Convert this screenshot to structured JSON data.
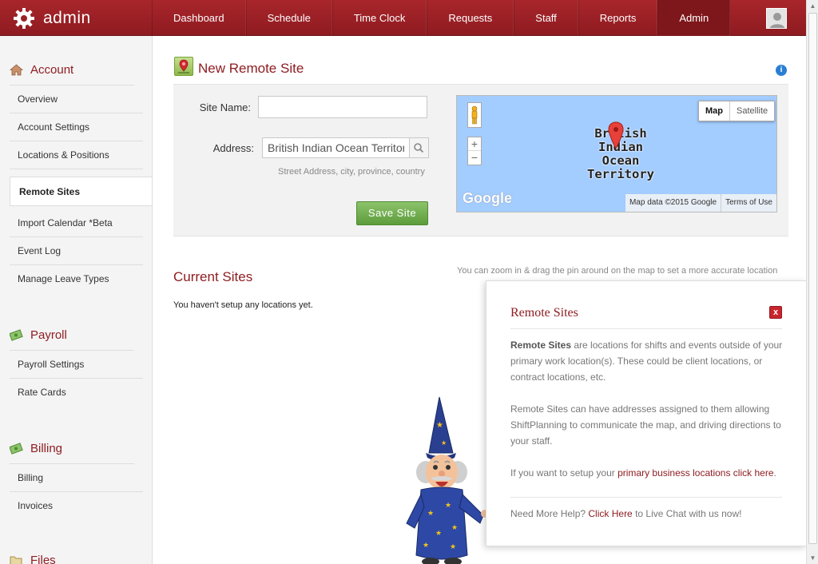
{
  "app": {
    "brand": "admin"
  },
  "nav": {
    "items": [
      {
        "label": "Dashboard"
      },
      {
        "label": "Schedule"
      },
      {
        "label": "Time Clock"
      },
      {
        "label": "Requests"
      },
      {
        "label": "Staff"
      },
      {
        "label": "Reports"
      },
      {
        "label": "Admin",
        "active": true
      }
    ]
  },
  "sidebar": {
    "account": {
      "title": "Account",
      "items": [
        "Overview",
        "Account Settings",
        "Locations & Positions",
        "Remote Sites",
        "Import Calendar *Beta",
        "Event Log",
        "Manage Leave Types"
      ],
      "active": "Remote Sites"
    },
    "payroll": {
      "title": "Payroll",
      "items": [
        "Payroll Settings",
        "Rate Cards"
      ]
    },
    "billing": {
      "title": "Billing",
      "items": [
        "Billing",
        "Invoices"
      ]
    },
    "files": {
      "title": "Files"
    }
  },
  "form": {
    "title": "New Remote Site",
    "site_name_label": "Site Name:",
    "site_name_value": "",
    "address_label": "Address:",
    "address_value": "British Indian Ocean Territory",
    "address_hint": "Street Address, city, province, country",
    "save_label": "Save Site"
  },
  "map": {
    "type_map": "Map",
    "type_satellite": "Satellite",
    "place_label_1": "British",
    "place_label_2": "Indian",
    "place_label_3": "Ocean",
    "place_label_4": "Territory",
    "zoom_in": "+",
    "zoom_out": "−",
    "logo": "Google",
    "attribution": "Map data ©2015 Google",
    "terms": "Terms of Use",
    "hint": "You can zoom in & drag the pin around on the map to set a more accurate location"
  },
  "current_sites": {
    "title": "Current Sites",
    "empty_message": "You haven't setup any locations yet."
  },
  "help": {
    "title": "Remote Sites",
    "close": "x",
    "p1_bold": "Remote Sites",
    "p1_rest": " are locations for shifts and events outside of your primary work location(s). These could be client locations, or contract locations, etc.",
    "p2": "Remote Sites can have addresses assigned to them allowing ShiftPlanning to communicate the map, and driving directions to your staff.",
    "p3_pre": "If you want to setup your ",
    "p3_link": "primary business locations click here",
    "p3_post": ".",
    "p4_pre": "Need More Help? ",
    "p4_link": "Click Here",
    "p4_post": " to Live Chat with us now!"
  },
  "colors": {
    "brand_red": "#a8262b",
    "title_red": "#8f1d22",
    "save_green": "#6ea94a",
    "map_water": "#a3ccff"
  },
  "icons": {
    "brand": "gear-icon",
    "account": "house-icon",
    "payroll": "money-icon",
    "billing": "money-icon",
    "files": "folder-icon",
    "title": "map-pin-icon",
    "info": "info-icon",
    "search": "search-icon"
  }
}
